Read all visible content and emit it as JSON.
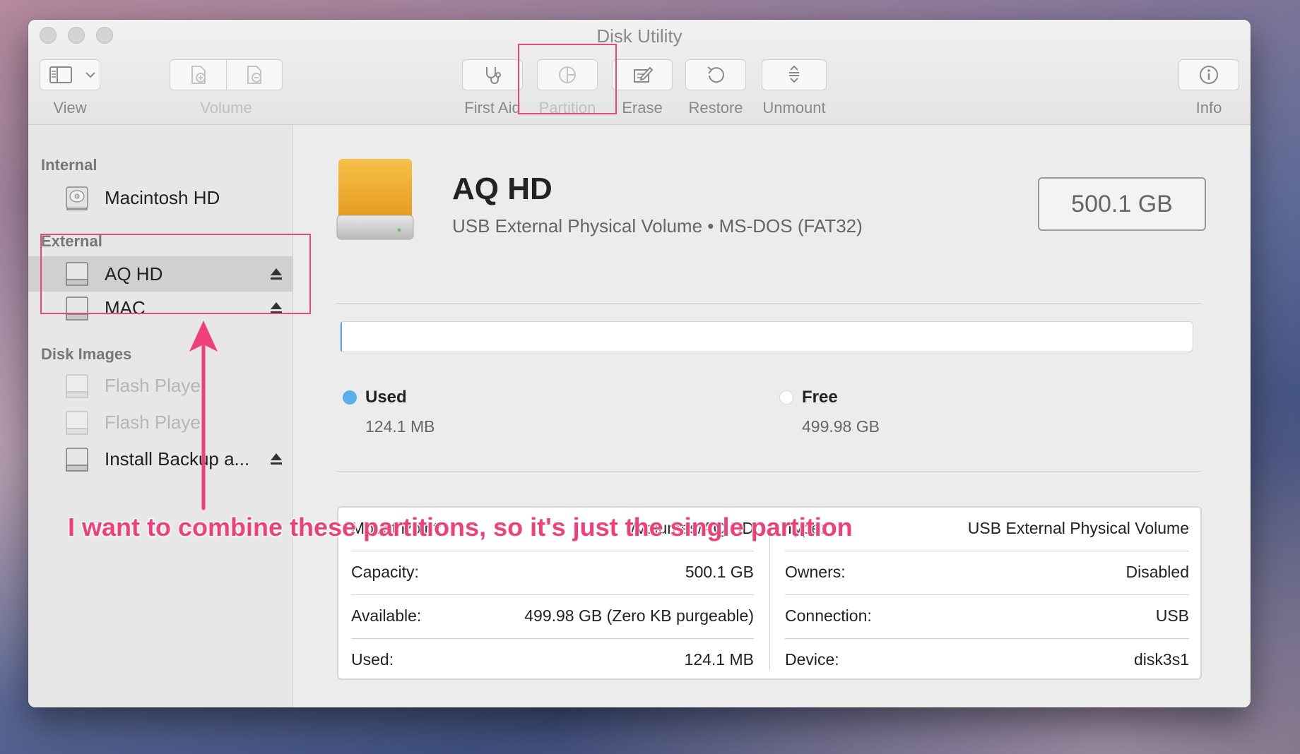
{
  "window": {
    "title": "Disk Utility"
  },
  "toolbar": {
    "view_label": "View",
    "volume_label": "Volume",
    "first_aid_label": "First Aid",
    "partition_label": "Partition",
    "erase_label": "Erase",
    "restore_label": "Restore",
    "unmount_label": "Unmount",
    "info_label": "Info"
  },
  "sidebar": {
    "sections": [
      {
        "header": "Internal",
        "items": [
          {
            "label": "Macintosh HD"
          }
        ]
      },
      {
        "header": "External",
        "items": [
          {
            "label": "AQ HD",
            "selected": true,
            "eject": true
          },
          {
            "label": "MAC",
            "eject": true
          }
        ]
      },
      {
        "header": "Disk Images",
        "items": [
          {
            "label": "Flash Playe",
            "dimmed": true
          },
          {
            "label": "Flash Playe",
            "dimmed": true
          },
          {
            "label": "Install Backup a...",
            "eject": true
          }
        ]
      }
    ]
  },
  "volume": {
    "name": "AQ HD",
    "subtitle": "USB External Physical Volume • MS-DOS (FAT32)",
    "size": "500.1 GB",
    "used_fraction": 0.0002
  },
  "usage": {
    "used_label": "Used",
    "used_value": "124.1 MB",
    "free_label": "Free",
    "free_value": "499.98 GB",
    "used_color": "#5aaeea",
    "free_color": "#ffffff"
  },
  "info": {
    "left": [
      {
        "key": "Mount Point:",
        "value": "/Volumes/AQ HD"
      },
      {
        "key": "Capacity:",
        "value": "500.1 GB"
      },
      {
        "key": "Available:",
        "value": "499.98 GB (Zero KB purgeable)"
      },
      {
        "key": "Used:",
        "value": "124.1 MB"
      }
    ],
    "right": [
      {
        "key": "Type:",
        "value": "USB External Physical Volume"
      },
      {
        "key": "Owners:",
        "value": "Disabled"
      },
      {
        "key": "Connection:",
        "value": "USB"
      },
      {
        "key": "Device:",
        "value": "disk3s1"
      }
    ]
  },
  "annotation": {
    "text": "I want to combine these partitions, so it's just the single partition",
    "color": "#e8487c"
  }
}
